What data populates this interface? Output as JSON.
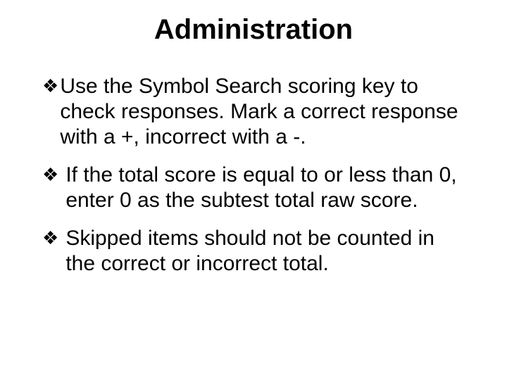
{
  "title": "Administration",
  "bullet_glyph": "❖",
  "bullets": [
    "Use the Symbol Search scoring key to check responses. Mark a correct response with a +, incorrect with a -.",
    "If the total score is equal to or less than 0, enter 0 as the subtest total raw score.",
    "Skipped items should not be counted in the correct or incorrect total."
  ]
}
